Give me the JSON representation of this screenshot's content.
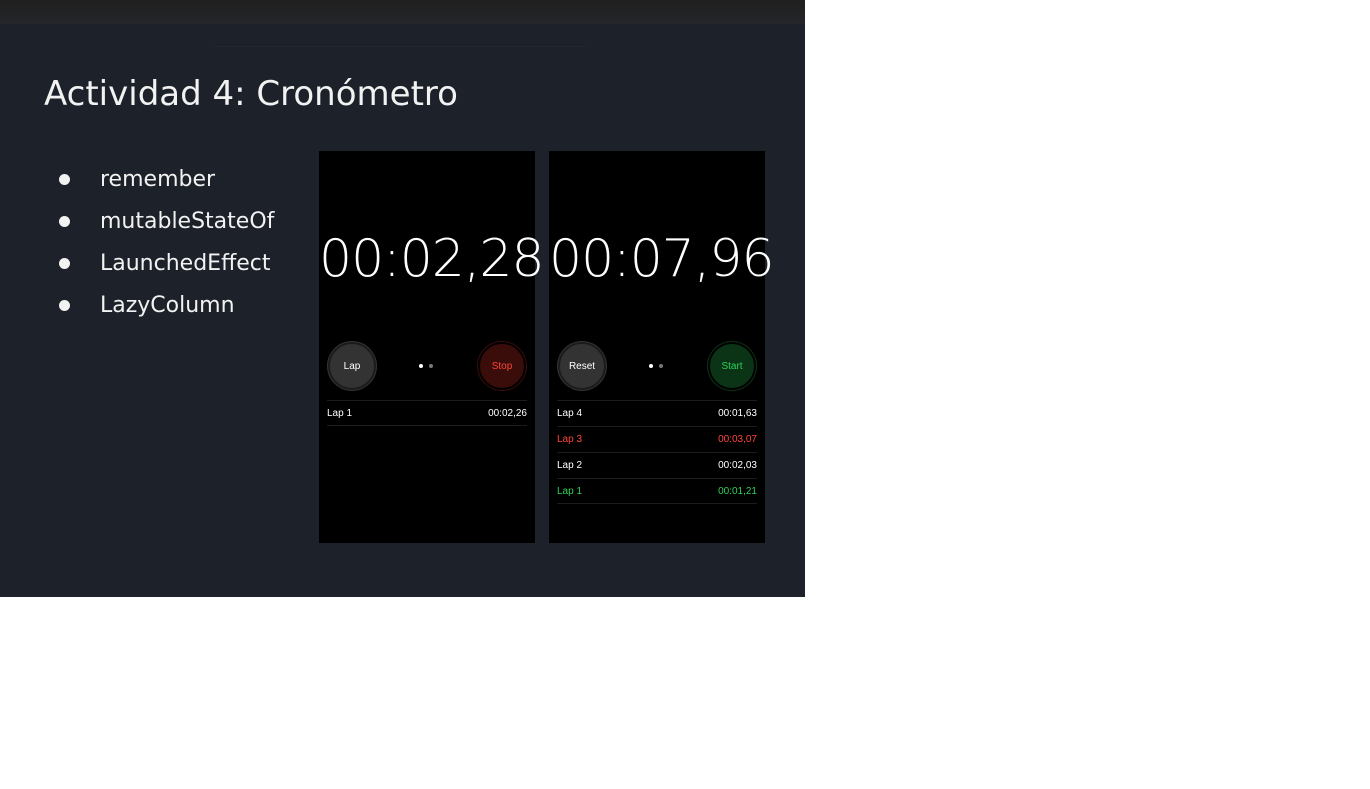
{
  "slide": {
    "title": "Actividad 4: Cronómetro",
    "bullets": [
      "remember",
      "mutableStateOf",
      "LaunchedEffect",
      "LazyColumn"
    ]
  },
  "phone1": {
    "time": "00:02,28",
    "left_button": "Lap",
    "right_button": "Stop",
    "laps": [
      {
        "label": "Lap 1",
        "time": "00:02,26",
        "color": "#ffffff"
      }
    ]
  },
  "phone2": {
    "time": "00:07,96",
    "left_button": "Reset",
    "right_button": "Start",
    "laps": [
      {
        "label": "Lap 4",
        "time": "00:01,63",
        "color": "#ffffff"
      },
      {
        "label": "Lap 3",
        "time": "00:03,07",
        "color": "#ff453a"
      },
      {
        "label": "Lap 2",
        "time": "00:02,03",
        "color": "#ffffff"
      },
      {
        "label": "Lap 1",
        "time": "00:01,21",
        "color": "#30d158"
      }
    ]
  },
  "colors": {
    "slide_bg": "#1d222a",
    "stop_red": "#ff453a",
    "start_green": "#30d158"
  }
}
